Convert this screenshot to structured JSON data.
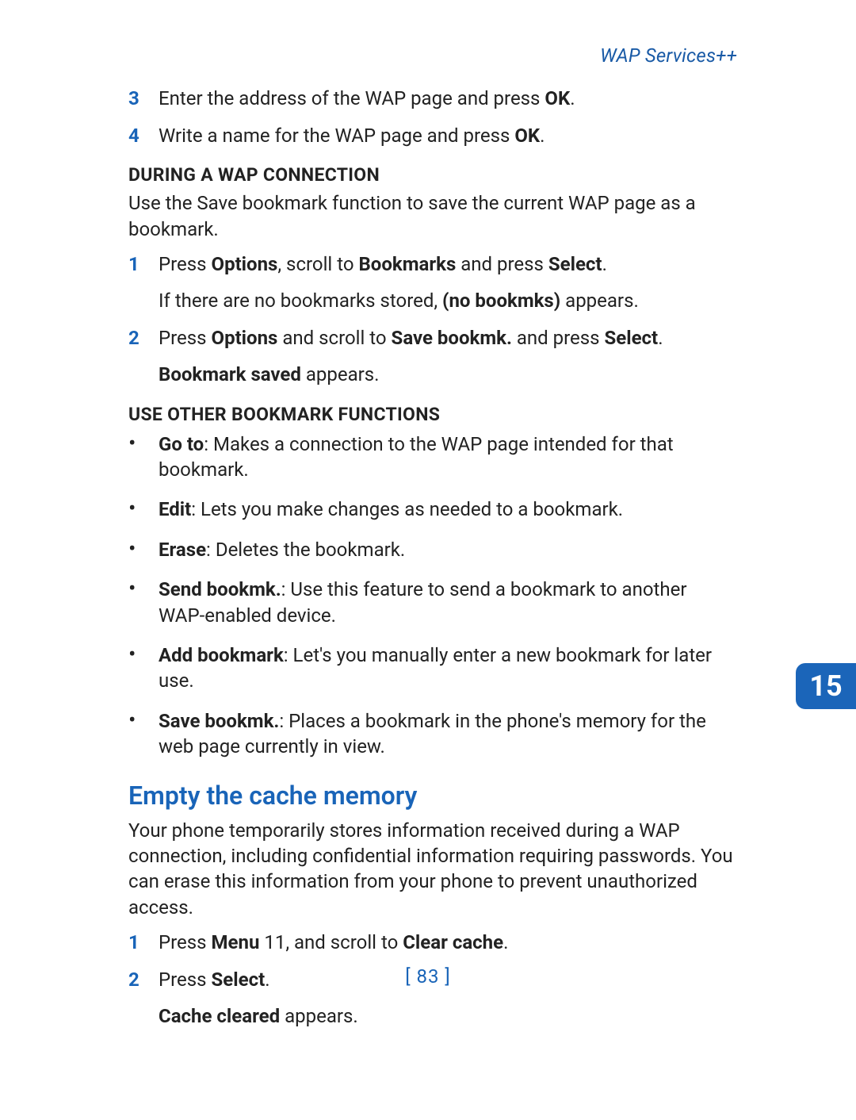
{
  "header": {
    "running_title": "WAP Services++"
  },
  "intro_steps": [
    {
      "num": "3",
      "parts": [
        "Enter the address of the WAP page and press ",
        "OK",
        "."
      ]
    },
    {
      "num": "4",
      "parts": [
        "Write a name for the WAP page and press ",
        "OK",
        "."
      ]
    }
  ],
  "subhead1": "DURING A WAP CONNECTION",
  "para1": "Use the Save bookmark function to save the current WAP page as a bookmark.",
  "steps1": [
    {
      "num": "1",
      "parts": [
        "Press ",
        "Options",
        ", scroll to ",
        "Bookmarks",
        " and press ",
        "Select",
        "."
      ],
      "followup_parts": [
        "If there are no bookmarks stored, ",
        "(no bookmks)",
        " appears."
      ]
    },
    {
      "num": "2",
      "parts": [
        "Press ",
        "Options",
        " and scroll to ",
        "Save bookmk.",
        " and press ",
        "Select",
        "."
      ],
      "followup_parts": [
        "",
        "Bookmark saved",
        " appears."
      ]
    }
  ],
  "subhead2": "USE OTHER BOOKMARK FUNCTIONS",
  "bullets": [
    {
      "bold": "Go to",
      "rest": ": Makes a connection to the WAP page intended for that bookmark."
    },
    {
      "bold": "Edit",
      "rest": ": Lets you make changes as needed to a bookmark."
    },
    {
      "bold": "Erase",
      "rest": ": Deletes the bookmark."
    },
    {
      "bold": "Send bookmk.",
      "rest": ": Use this feature to send a bookmark to another WAP-enabled device."
    },
    {
      "bold": "Add bookmark",
      "rest": ": Let's you manually enter a new bookmark for later use."
    },
    {
      "bold": "Save bookmk.",
      "rest": ": Places a bookmark in the phone's memory for the web page currently in view."
    }
  ],
  "section_title": "Empty the cache memory",
  "section_para": "Your phone temporarily stores information received during a WAP connection, including confidential information requiring passwords. You can erase this information from your phone to prevent unauthorized access.",
  "steps2": [
    {
      "num": "1",
      "parts": [
        "Press ",
        "Menu",
        " 11, and scroll to ",
        "Clear cache",
        "."
      ]
    },
    {
      "num": "2",
      "parts": [
        "Press ",
        "Select",
        "."
      ],
      "followup_parts": [
        "",
        "Cache cleared",
        " appears."
      ]
    }
  ],
  "page_number": "[ 83 ]",
  "side_tab": "15"
}
